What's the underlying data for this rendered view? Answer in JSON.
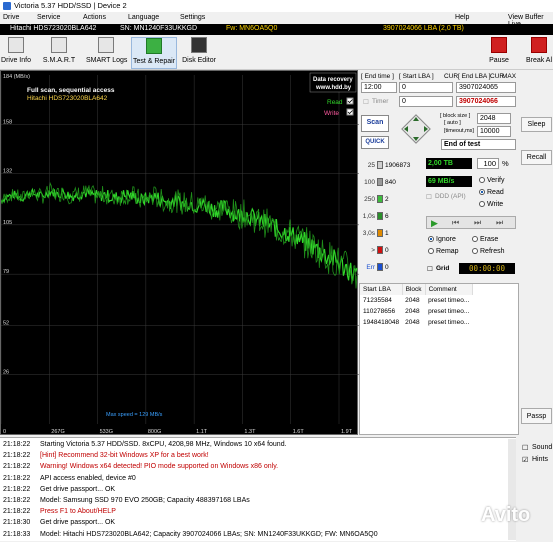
{
  "window": {
    "title": "Victoria 5.37 HDD/SSD | Device 2"
  },
  "menu": [
    "Drive",
    "Service",
    "Actions",
    "Language",
    "Settings",
    "Help",
    "View Buffer Live"
  ],
  "infobar": {
    "model": "Hitachi HDS723020BLA642",
    "serial": "SN: MN1240F33UKKGD",
    "firmware": "Fw: MN6OA5Q0",
    "lba": "3907024066 LBA (2,0 TB)"
  },
  "toolbar": {
    "buttons": [
      "Drive Info",
      "S.M.A.R.T",
      "SMART Logs",
      "Test & Repair",
      "Disk Editor"
    ],
    "pause": "Pause",
    "break_all": "Break Al"
  },
  "graph": {
    "title": "Full scan, sequential access",
    "drive": "Hitachi HDS723020BLA642",
    "y_unit": "184 (MB/s)",
    "y_ticks": [
      "158",
      "132",
      "105",
      "79",
      "52",
      "26"
    ],
    "x_ticks": [
      "0",
      "267G",
      "533G",
      "800G",
      "1.1T",
      "1.3T",
      "1.6T",
      "1.9T"
    ],
    "logo_line1": "Data recovery",
    "logo_line2": "www.hdd.by",
    "read_label": "Read",
    "write_label": "Write",
    "max_speed": "Max speed = 129 MB/s",
    "speed_trace": [
      118,
      120,
      121,
      119,
      122,
      121,
      120,
      123,
      121,
      122,
      120,
      121,
      122,
      121,
      120,
      121,
      119,
      120,
      121,
      120,
      118,
      119,
      120,
      118,
      117,
      118,
      116,
      117,
      115,
      116,
      114,
      113,
      114,
      112,
      110,
      111,
      109,
      107,
      106,
      104,
      102,
      101,
      99,
      97,
      95,
      93,
      90,
      88,
      86,
      83,
      81,
      78
    ]
  },
  "controls": {
    "end_time_label": "[ End time ]",
    "end_time_value": "12:00",
    "start_lba_label": "[ Start LBA ]",
    "start_lba_value": "0",
    "start_lba_cur_label": "CUR",
    "start_lba_right": "3907024065",
    "end_lba_label": "[ End LBA ]",
    "end_lba_cur": "CUR",
    "end_lba_max": "MAX",
    "end_lba_value": "3907024065",
    "timer_label": "Timer",
    "timer_value": "0",
    "end_lba_red": "3907024066",
    "block_size_label": "[ block size ]",
    "block_size_auto": "[ auto ]",
    "block_size_value": "2048",
    "timeout_label": "[timeout,ms]",
    "timeout_value": "10000",
    "scan_button": "Scan",
    "quick_button": "QUICK",
    "end_of_test": "End of test",
    "sleep_button": "Sleep",
    "recall_button": "Recall",
    "passp_button": "Passp"
  },
  "blocks": [
    {
      "label": "25",
      "count": "1906873",
      "color": "#cfcfcf"
    },
    {
      "label": "100",
      "count": "840",
      "color": "#9a9a9a"
    },
    {
      "label": "250",
      "count": "2",
      "color": "#3dbb3d"
    },
    {
      "label": "1,0s",
      "count": "6",
      "color": "#2a8f2a"
    },
    {
      "label": "3,0s",
      "count": "1",
      "color": "#e08a00"
    },
    {
      "label": ">",
      "count": "0",
      "color": "#d01010"
    },
    {
      "label": "Err",
      "count": "0",
      "color": "#1a4fd0"
    }
  ],
  "status": {
    "size": "2,00 TB",
    "percent": "100",
    "percent_sign": "%",
    "speed": "69 MB/s",
    "verify": "Verify",
    "read": "Read",
    "write": "Write",
    "ddd_api": "DDD (API)",
    "ignore": "Ignore",
    "erase": "Erase",
    "remap": "Remap",
    "refresh": "Refresh",
    "grid": "Grid",
    "clock": "00:00:00"
  },
  "lba_table": {
    "headers": [
      "Start LBA",
      "Block",
      "Comment"
    ],
    "rows": [
      [
        "71235584",
        "2048",
        "preset timeo..."
      ],
      [
        "110278656",
        "2048",
        "preset timeo..."
      ],
      [
        "1948418048",
        "2048",
        "preset timeo..."
      ]
    ]
  },
  "log": [
    {
      "time": "21:18:22",
      "msg": "Starting Victoria 5.37 HDD/SSD. 8xCPU, 4208,98 MHz, Windows 10 x64 found.",
      "color": "#000000"
    },
    {
      "time": "21:18:22",
      "msg": "[Hint] Recommend 32-bit Windows XP for a best work!",
      "color": "#c00000"
    },
    {
      "time": "21:18:22",
      "msg": "Warning! Windows x64 detected! PIO mode supported on Windows x86 only.",
      "color": "#c00000"
    },
    {
      "time": "21:18:22",
      "msg": "API access enabled, device #0",
      "color": "#000000"
    },
    {
      "time": "21:18:22",
      "msg": "Get drive passport... OK",
      "color": "#000000"
    },
    {
      "time": "21:18:22",
      "msg": "Model: Samsung SSD 970 EVO 250GB; Capacity 488397168 LBAs",
      "color": "#000000"
    },
    {
      "time": "21:18:22",
      "msg": "Press F1 to About/HELP",
      "color": "#c00000"
    },
    {
      "time": "21:18:30",
      "msg": "Get drive passport... OK",
      "color": "#000000"
    },
    {
      "time": "21:18:33",
      "msg": "Model: Hitachi HDS723020BLA642; Capacity 3907024066 LBAs; SN: MN1240F33UKKGD; FW: MN6OA5Q0",
      "color": "#000000"
    }
  ],
  "side_checks": {
    "sound": "Sound",
    "hints": "Hints"
  },
  "watermark": "Avito"
}
